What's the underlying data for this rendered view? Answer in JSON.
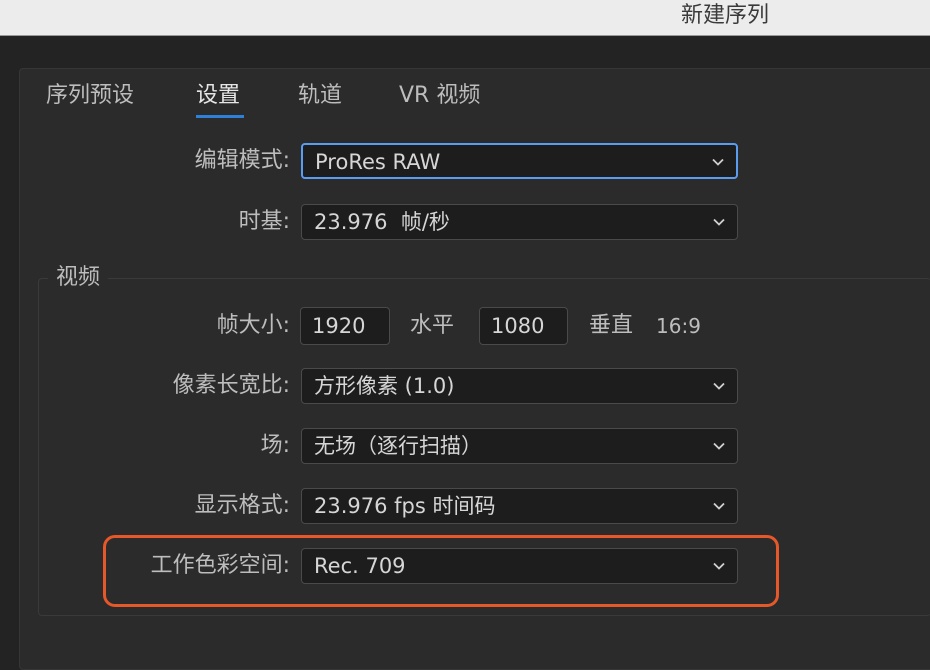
{
  "window": {
    "title": "新建序列"
  },
  "tabs": [
    {
      "label": "序列预设"
    },
    {
      "label": "设置"
    },
    {
      "label": "轨道"
    },
    {
      "label": "VR 视频"
    }
  ],
  "settings": {
    "edit_mode": {
      "label": "编辑模式:",
      "value": "ProRes RAW"
    },
    "timebase": {
      "label": "时基:",
      "value": "23.976  帧/秒"
    }
  },
  "video": {
    "title": "视频",
    "frame_size": {
      "label": "帧大小:",
      "width": "1920",
      "horizontal_label": "水平",
      "height": "1080",
      "vertical_label": "垂直",
      "aspect": "16:9"
    },
    "pixel_aspect": {
      "label": "像素长宽比:",
      "value": "方形像素 (1.0)"
    },
    "fields": {
      "label": "场:",
      "value": "无场（逐行扫描）"
    },
    "display_format": {
      "label": "显示格式:",
      "value": "23.976 fps 时间码"
    },
    "working_color_space": {
      "label": "工作色彩空间:",
      "value": "Rec. 709"
    }
  },
  "colors": {
    "active_tab_underline": "#2f80d9",
    "focus_border": "#5a9cf0",
    "highlight_box": "#e4582a"
  },
  "icons": {
    "dropdown": "chevron-down-icon"
  }
}
